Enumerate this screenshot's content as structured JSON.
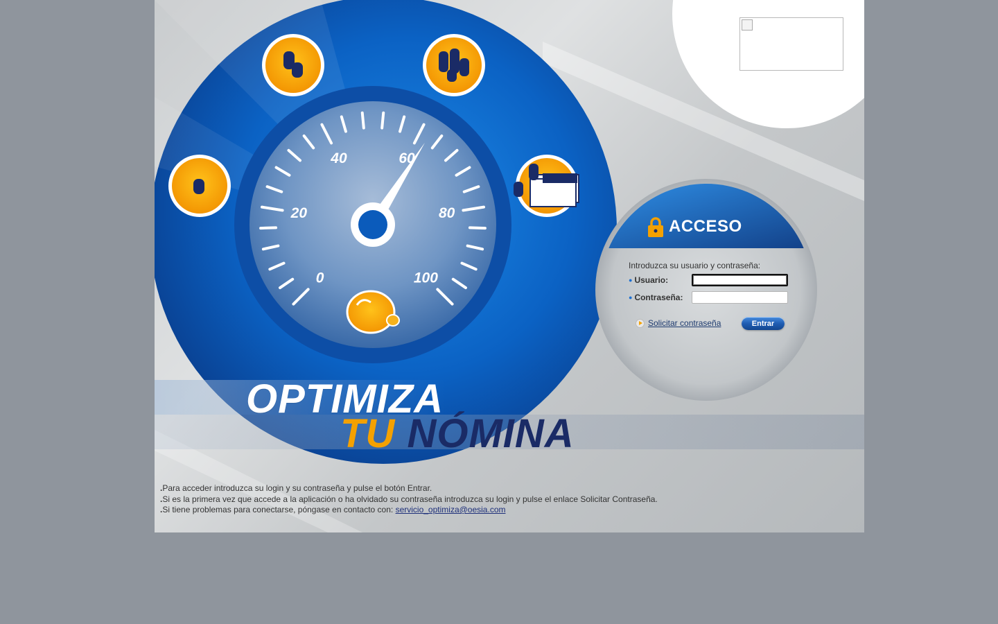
{
  "gauge": {
    "ticks": [
      "0",
      "20",
      "40",
      "60",
      "80",
      "100"
    ],
    "needle_value": 62
  },
  "slogan": {
    "line1": "OPTIMIZA",
    "line2_a": "TU",
    "line2_b": "NÓMINA"
  },
  "login": {
    "title": "ACCESO",
    "intro": "Introduzca su usuario y contraseña:",
    "user_label": "Usuario:",
    "password_label": "Contraseña:",
    "user_value": "",
    "password_value": "",
    "request_password_label": "Solicitar contraseña",
    "enter_label": "Entrar"
  },
  "notes": {
    "line1": "Para acceder introduzca su login y su contraseña y pulse el botón Entrar.",
    "line2": "Si es la primera vez que accede a la aplicación o ha olvidado su contraseña introduzca su login y pulse el enlace Solicitar Contraseña.",
    "line3_prefix": "Si tiene problemas para conectarse, póngase en contacto con:",
    "contact_email": "servicio_optimiza@oesia.com"
  },
  "colors": {
    "page_bg": "#8f959d",
    "brand_blue": "#0a5bb5",
    "brand_orange": "#f4a100",
    "navy": "#1a2b66"
  },
  "icons": [
    "coins-icon",
    "piggy-bank-icon",
    "banknotes-icon",
    "lock-icon",
    "arrow-icon"
  ]
}
